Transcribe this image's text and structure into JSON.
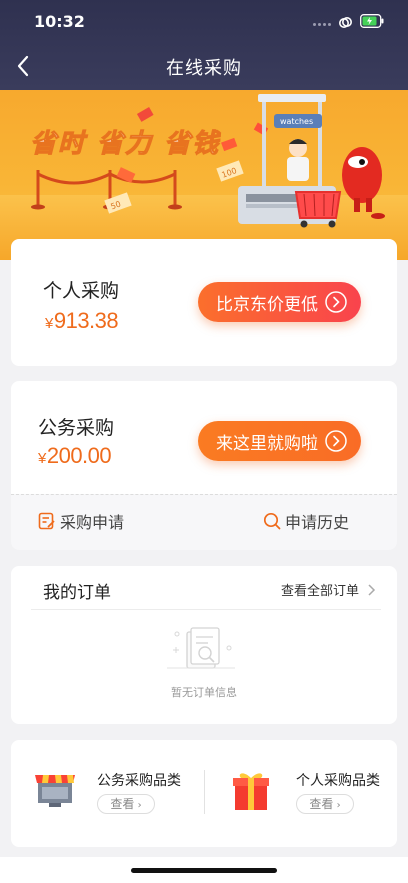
{
  "status": {
    "time": "10:32"
  },
  "nav": {
    "title": "在线采购"
  },
  "banner": {
    "slogan": "省时 省力 省钱",
    "sign": "watches",
    "tag1": "100",
    "tag2": "50"
  },
  "personal": {
    "title": "个人采购",
    "currency": "¥",
    "amount": "913.38",
    "button": "比京东价更低"
  },
  "business": {
    "title": "公务采购",
    "currency": "¥",
    "amount": "200.00",
    "button": "来这里就购啦"
  },
  "actions": {
    "apply": "采购申请",
    "history": "申请历史"
  },
  "orders": {
    "title": "我的订单",
    "view_all": "查看全部订单",
    "empty": "暂无订单信息"
  },
  "categories": [
    {
      "name": "公务采购品类",
      "button": "查看"
    },
    {
      "name": "个人采购品类",
      "button": "查看"
    }
  ],
  "colors": {
    "accent": "#ef6b1c",
    "header": "#2f3150",
    "banner": "#f9b536"
  }
}
